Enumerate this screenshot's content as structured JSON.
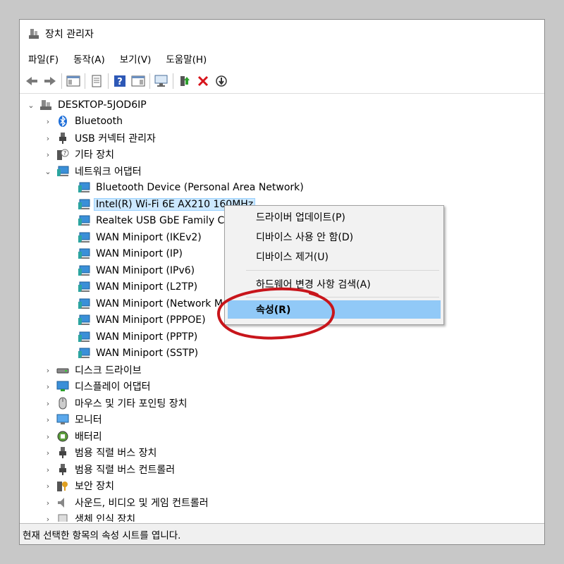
{
  "window": {
    "title": "장치 관리자"
  },
  "menu": [
    "파일(F)",
    "동작(A)",
    "보기(V)",
    "도움말(H)"
  ],
  "toolbar": [
    "back-icon",
    "forward-icon",
    "show-hide-tree-icon",
    "properties-icon",
    "help-icon",
    "action-pane-icon",
    "scan-hardware-icon",
    "update-driver-icon",
    "uninstall-icon",
    "disable-icon"
  ],
  "tree": {
    "root": "DESKTOP-5JOD6IP",
    "categories": [
      {
        "label": "Bluetooth",
        "icon": "bluetooth-icon",
        "expanded": false
      },
      {
        "label": "USB 커넥터 관리자",
        "icon": "usb-connector-icon",
        "expanded": false
      },
      {
        "label": "기타 장치",
        "icon": "other-devices-icon",
        "expanded": false
      },
      {
        "label": "네트워크 어댑터",
        "icon": "network-adapter-icon",
        "expanded": true
      }
    ],
    "network_children": [
      "Bluetooth Device (Personal Area Network)",
      "Intel(R) Wi-Fi 6E AX210 160MHz",
      "Realtek USB GbE Family C",
      "WAN Miniport (IKEv2)",
      "WAN Miniport (IP)",
      "WAN Miniport (IPv6)",
      "WAN Miniport (L2TP)",
      "WAN Miniport (Network M",
      "WAN Miniport (PPPOE)",
      "WAN Miniport (PPTP)",
      "WAN Miniport (SSTP)"
    ],
    "categories_after": [
      {
        "label": "디스크 드라이브",
        "icon": "disk-drive-icon"
      },
      {
        "label": "디스플레이 어댑터",
        "icon": "display-adapter-icon"
      },
      {
        "label": "마우스 및 기타 포인팅 장치",
        "icon": "mouse-icon"
      },
      {
        "label": "모니터",
        "icon": "monitor-icon"
      },
      {
        "label": "배터리",
        "icon": "battery-icon"
      },
      {
        "label": "범용 직렬 버스 장치",
        "icon": "usb-device-icon"
      },
      {
        "label": "범용 직렬 버스 컨트롤러",
        "icon": "usb-controller-icon"
      },
      {
        "label": "보안 장치",
        "icon": "security-device-icon"
      },
      {
        "label": "사운드, 비디오 및 게임 컨트롤러",
        "icon": "sound-icon"
      },
      {
        "label": "생체 인식 장치",
        "icon": "biometric-icon"
      }
    ]
  },
  "context_menu": {
    "items": [
      "드라이버 업데이트(P)",
      "디바이스 사용 안 함(D)",
      "디바이스 제거(U)",
      "하드웨어 변경 사항 검색(A)",
      "속성(R)"
    ],
    "highlighted_index": 4
  },
  "status": "현재 선택한 항목의 속성 시트를 엽니다.",
  "colors": {
    "selection": "#cce8ff",
    "menu_highlight": "#91c9f7",
    "annotation": "#c8151b"
  }
}
